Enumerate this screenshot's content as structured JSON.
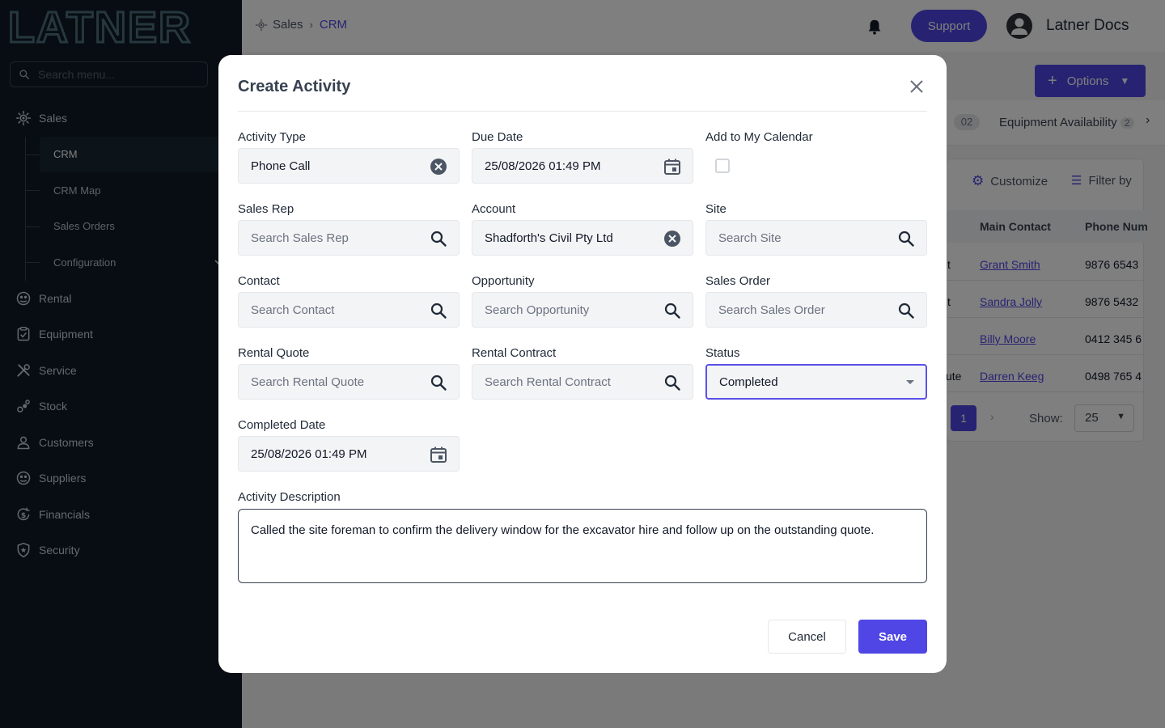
{
  "brand": {
    "logo_text": "LATNER",
    "accent": "#4f46e5",
    "sidebar_bg": "#0f1a24"
  },
  "sidebar": {
    "search_placeholder": "Search menu...",
    "sales_label": "Sales",
    "sub_items": [
      "CRM",
      "CRM Map",
      "Sales Orders",
      "Configuration"
    ],
    "items": [
      "Rental",
      "Equipment",
      "Service",
      "Stock",
      "Customers",
      "Suppliers",
      "Financials",
      "Security"
    ]
  },
  "topbar": {
    "breadcrumb": [
      "Sales",
      "CRM"
    ],
    "support_label": "Support",
    "user_name": "Latner Docs"
  },
  "background": {
    "options_label": "Options",
    "tab_badge": "02",
    "tab_label": "Equipment Availability",
    "tab_badge_2": "2",
    "customize_label": "Customize",
    "filter_label": "Filter by",
    "columns": [
      "Main Contact",
      "Phone Num"
    ],
    "row_prefixes": [
      "t",
      "t",
      "",
      "ute"
    ],
    "rows": [
      {
        "contact": "Grant Smith",
        "phone": "9876 6543"
      },
      {
        "contact": "Sandra Jolly",
        "phone": "9876 5432"
      },
      {
        "contact": "Billy Moore",
        "phone": "0412 345 6"
      },
      {
        "contact": "Darren Keeg",
        "phone": "0498 765 4"
      }
    ],
    "current_page": "1",
    "show_label": "Show:",
    "show_value": "25"
  },
  "modal": {
    "title": "Create Activity",
    "fields": {
      "activity_type": {
        "label": "Activity Type",
        "value": "Phone Call"
      },
      "due_date": {
        "label": "Due Date",
        "value": "25/08/2026 01:49 PM"
      },
      "add_calendar": {
        "label": "Add to My Calendar"
      },
      "sales_rep": {
        "label": "Sales Rep",
        "placeholder": "Search Sales Rep"
      },
      "account": {
        "label": "Account",
        "value": "Shadforth's Civil Pty Ltd"
      },
      "site": {
        "label": "Site",
        "placeholder": "Search Site"
      },
      "contact": {
        "label": "Contact",
        "placeholder": "Search Contact"
      },
      "opportunity": {
        "label": "Opportunity",
        "placeholder": "Search Opportunity"
      },
      "sales_order": {
        "label": "Sales Order",
        "placeholder": "Search Sales Order"
      },
      "rental_quote": {
        "label": "Rental Quote",
        "placeholder": "Search Rental Quote"
      },
      "rental_contract": {
        "label": "Rental Contract",
        "placeholder": "Search Rental Contract"
      },
      "status": {
        "label": "Status",
        "value": "Completed"
      },
      "completed_date": {
        "label": "Completed Date",
        "value": "25/08/2026 01:49 PM"
      },
      "description": {
        "label": "Activity Description",
        "value": "Called the site foreman to confirm the delivery window for the excavator hire and follow up on the outstanding quote."
      }
    },
    "cancel_label": "Cancel",
    "save_label": "Save"
  }
}
